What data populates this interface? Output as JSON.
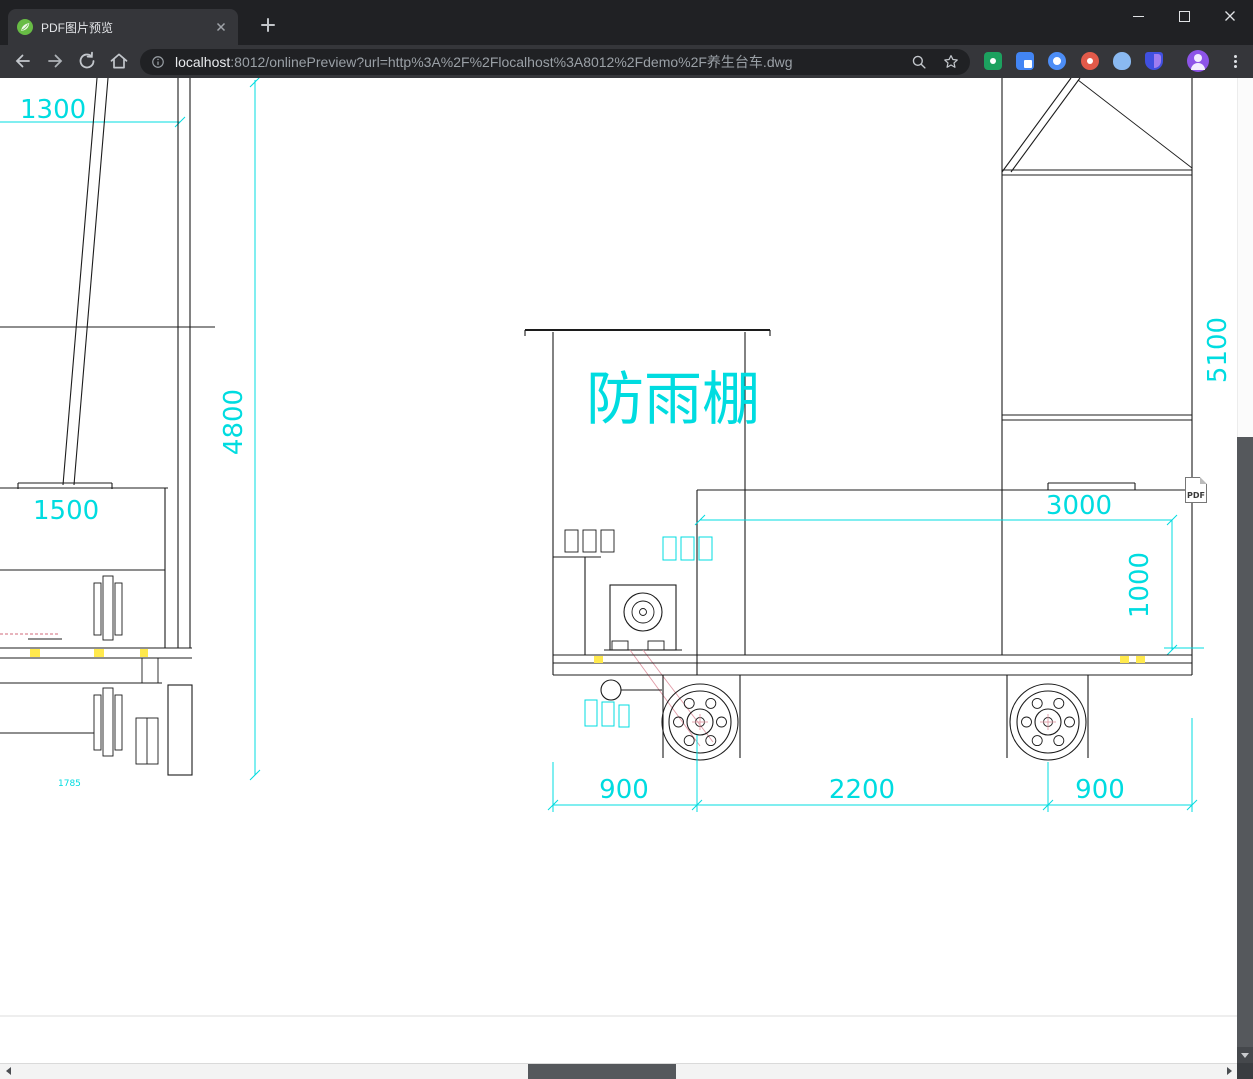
{
  "tab": {
    "title": "PDF图片预览"
  },
  "toolbar": {
    "url_host": "localhost",
    "url_rest": ":8012/onlinePreview?url=http%3A%2F%2Flocalhost%3A8012%2Fdemo%2F养生台车.dwg"
  },
  "viewer": {
    "pdf_badge": "PDF"
  },
  "drawing": {
    "labels": {
      "shed": "防雨棚"
    },
    "dims": {
      "d1300": "1300",
      "d4800": "4800",
      "d1500": "1500",
      "d3000": "3000",
      "d1000": "1000",
      "d5100": "5100",
      "d900_left": "900",
      "d2200": "2200",
      "d900_right": "900",
      "d_small": "1785"
    },
    "colors": {
      "dimension": "#00dce0",
      "line": "#1c1c1c",
      "highlight_yellow": "#ffe94d",
      "hatch_red": "#e09aa6"
    }
  }
}
